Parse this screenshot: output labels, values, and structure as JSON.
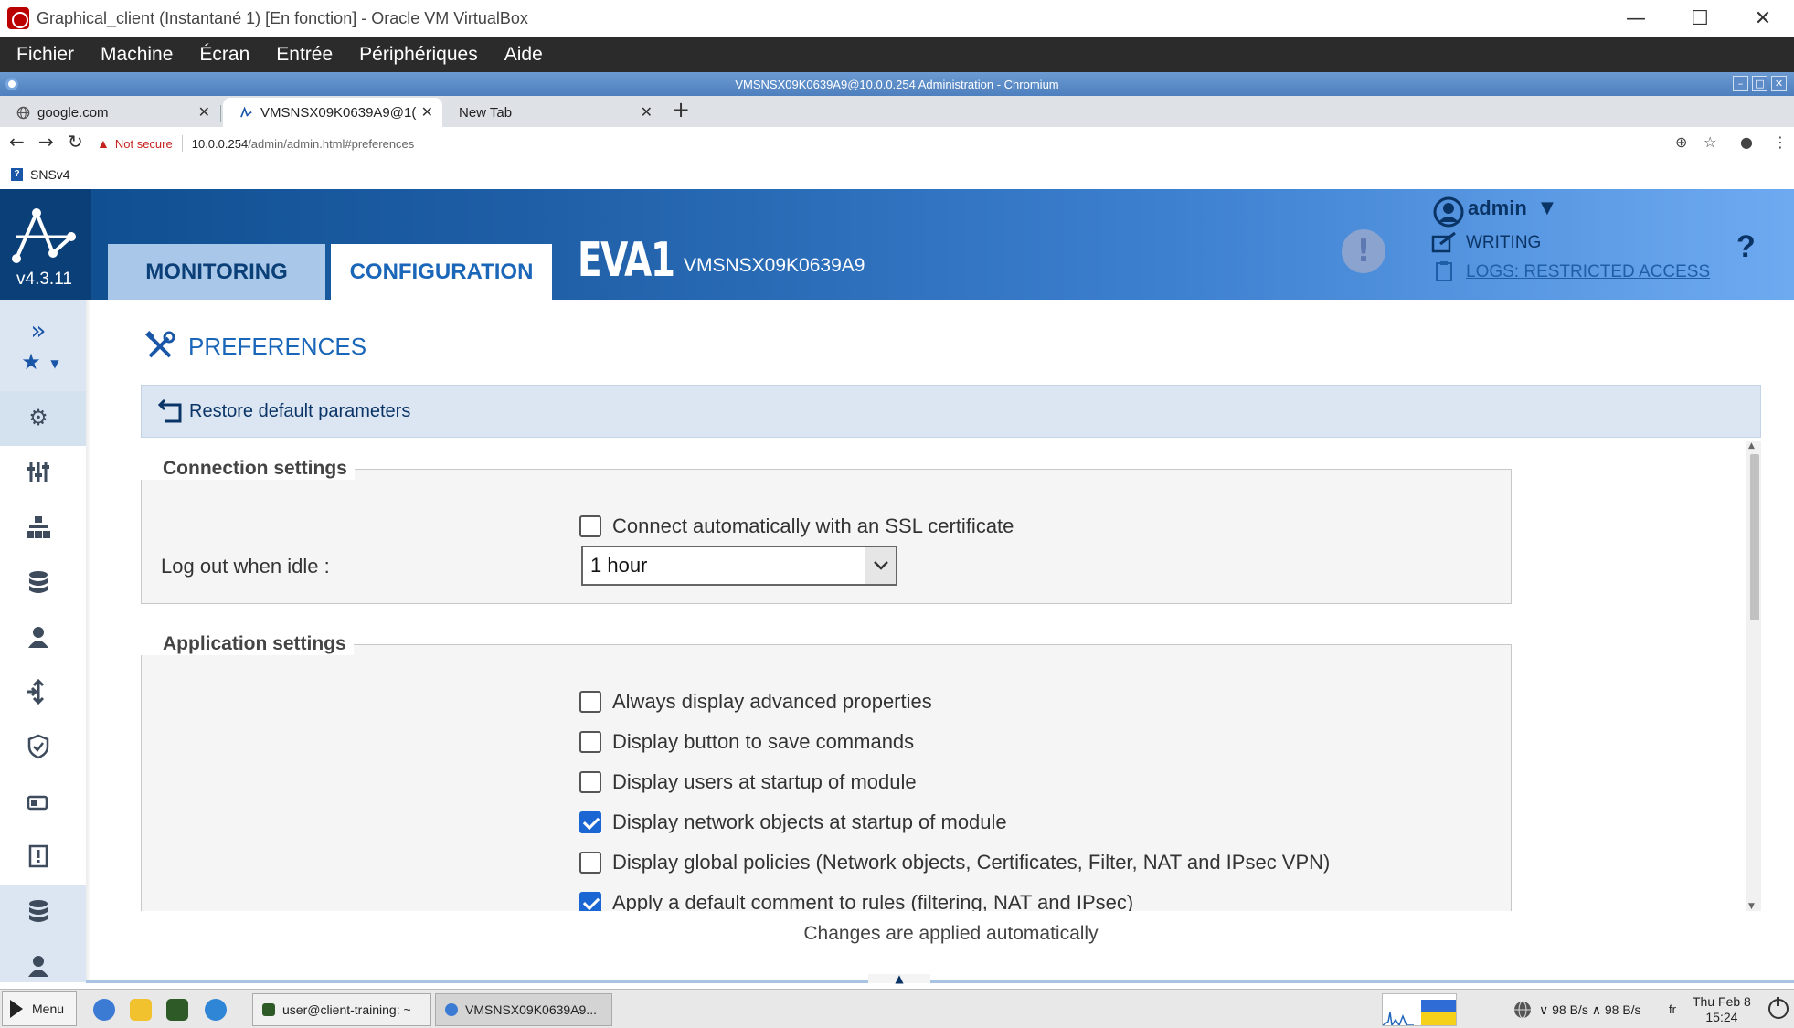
{
  "vbox": {
    "title": "Graphical_client (Instantané 1) [En fonction] - Oracle VM VirtualBox",
    "menu": [
      "Fichier",
      "Machine",
      "Écran",
      "Entrée",
      "Périphériques",
      "Aide"
    ],
    "minimize": "—",
    "maximize": "☐",
    "close": "✕"
  },
  "browser": {
    "window_title": "VMSNSX09K0639A9@10.0.0.254 Administration - Chromium",
    "tabs": [
      {
        "label": "google.com",
        "icon": "globe-icon"
      },
      {
        "label": "VMSNSX09K0639A9@1(",
        "icon": "stormshield-icon"
      },
      {
        "label": "New Tab",
        "icon": ""
      }
    ],
    "security_label": "Not secure",
    "url_host": "10.0.0.254",
    "url_path": "/admin/admin.html#preferences",
    "bookmark": "SNSv4"
  },
  "app": {
    "version": "v4.3.11",
    "tabs": {
      "monitoring": "MONITORING",
      "configuration": "CONFIGURATION"
    },
    "firewall_name": "EVA1",
    "firewall_serial": "VMSNSX09K0639A9",
    "user": "admin",
    "writing": "WRITING",
    "logs": "LOGS: RESTRICTED ACCESS",
    "help": "?",
    "alarm": "!"
  },
  "page": {
    "title": "PREFERENCES",
    "restore": "Restore default parameters",
    "connection_settings": {
      "legend": "Connection settings",
      "ssl_checkbox": {
        "label": "Connect automatically with an SSL certificate",
        "checked": false
      },
      "idle_label": "Log out when idle :",
      "idle_value": "1 hour"
    },
    "application_settings": {
      "legend": "Application settings",
      "options": [
        {
          "label": "Always display advanced properties",
          "checked": false
        },
        {
          "label": "Display button to save commands",
          "checked": false
        },
        {
          "label": "Display users at startup of module",
          "checked": false
        },
        {
          "label": "Display network objects at startup of module",
          "checked": true
        },
        {
          "label": "Display global policies (Network objects, Certificates, Filter, NAT and IPsec VPN)",
          "checked": false
        },
        {
          "label": "Apply a default comment to rules (filtering, NAT and IPsec)",
          "checked": true
        }
      ]
    },
    "footer": "Changes are applied automatically"
  },
  "taskbar": {
    "menu": "Menu",
    "tasks": [
      {
        "label": "user@client-training: ~",
        "active": false
      },
      {
        "label": "VMSNSX09K0639A9...",
        "active": true
      }
    ],
    "net": "∨ 98 B/s ∧ 98 B/s",
    "lang": "fr",
    "date": "Thu Feb 8",
    "time": "15:24"
  }
}
